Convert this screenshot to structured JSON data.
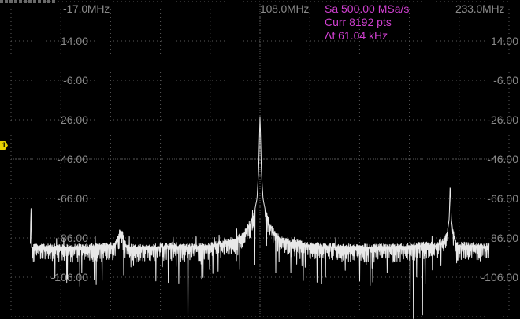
{
  "header": {
    "freq_start": "-17.0MHz",
    "freq_center": "108.0MHz",
    "freq_end": "233.0MHz"
  },
  "info": {
    "sample_rate": "Sa 500.00 MSa/s",
    "points": "Curr 8192 pts",
    "resolution": "Δf 61.04 kHz"
  },
  "channel_marker": {
    "label": "1",
    "color": "#e6d200"
  },
  "colors": {
    "trace": "#e8e8e8",
    "grid": "#5a5a5a",
    "info_text": "#d040d0",
    "label_text": "#8a8a8a"
  },
  "chart_data": {
    "type": "line",
    "title": "",
    "xlabel": "",
    "ylabel": "",
    "x_unit": "MHz",
    "xlim": [
      -17.0,
      233.0
    ],
    "ylim": [
      -126,
      34
    ],
    "y_ticks": [
      "14.00",
      "-6.00",
      "-26.00",
      "-46.00",
      "-66.00",
      "-86.00",
      "-106.00"
    ],
    "y_tick_values": [
      14,
      -6,
      -26,
      -46,
      -66,
      -86,
      -106
    ],
    "grid": true,
    "series": [
      {
        "x": [
          -7.3,
          -7.0,
          -6.7,
          0.0,
          7.3,
          21.1,
          35.0,
          37.0,
          38.0,
          39.0,
          41.0,
          55.0,
          63.9,
          69.0,
          83.0,
          96.0,
          100.0,
          103.0,
          105.0,
          106.5,
          107.3,
          108.0,
          108.7,
          109.5,
          111.0,
          113.0,
          116.0,
          120.0,
          133.0,
          147.0,
          161.0,
          175.0,
          189.0,
          196.0,
          200.0,
          202.0,
          203.0,
          203.5,
          204.0,
          205.0,
          207.0,
          214.0,
          221.0,
          223.0
        ],
        "values": [
          -89,
          -69,
          -91,
          -91,
          -91,
          -91,
          -90,
          -85,
          -82,
          -85,
          -91,
          -91,
          -90,
          -91,
          -90,
          -87,
          -84,
          -79,
          -74,
          -66,
          -52,
          -24,
          -52,
          -66,
          -74,
          -80,
          -85,
          -88,
          -90,
          -91,
          -91,
          -91,
          -90,
          -90,
          -88,
          -84,
          -76,
          -58,
          -76,
          -84,
          -90,
          -90,
          -91,
          -90
        ]
      }
    ]
  }
}
